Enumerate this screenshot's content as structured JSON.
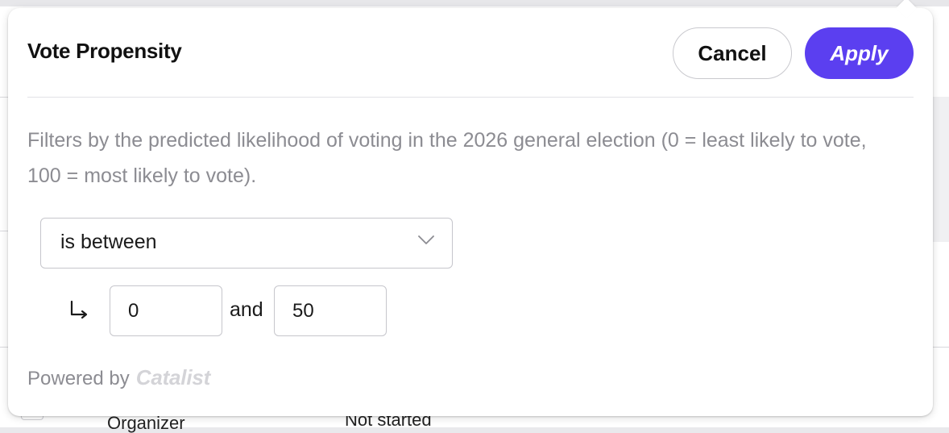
{
  "filter": {
    "title": "Vote Propensity",
    "cancel_label": "Cancel",
    "apply_label": "Apply",
    "description": "Filters by the predicted likelihood of voting in the 2026 general election (0 = least likely to vote, 100 = most likely to vote).",
    "operator": {
      "selected": "is between",
      "icon": "chevron-down-icon"
    },
    "range": {
      "min_value": "0",
      "max_value": "50",
      "joiner": "and",
      "icon": "subdirectory-arrow-icon"
    },
    "powered_by": {
      "label": "Powered by",
      "brand": "Catalist"
    }
  },
  "background": {
    "row": {
      "organizer": "Organizer",
      "status": "Not started"
    }
  },
  "colors": {
    "apply_bg": "#5b3ff0",
    "muted_text": "#8c8c92",
    "border": "#c6c6cc"
  }
}
